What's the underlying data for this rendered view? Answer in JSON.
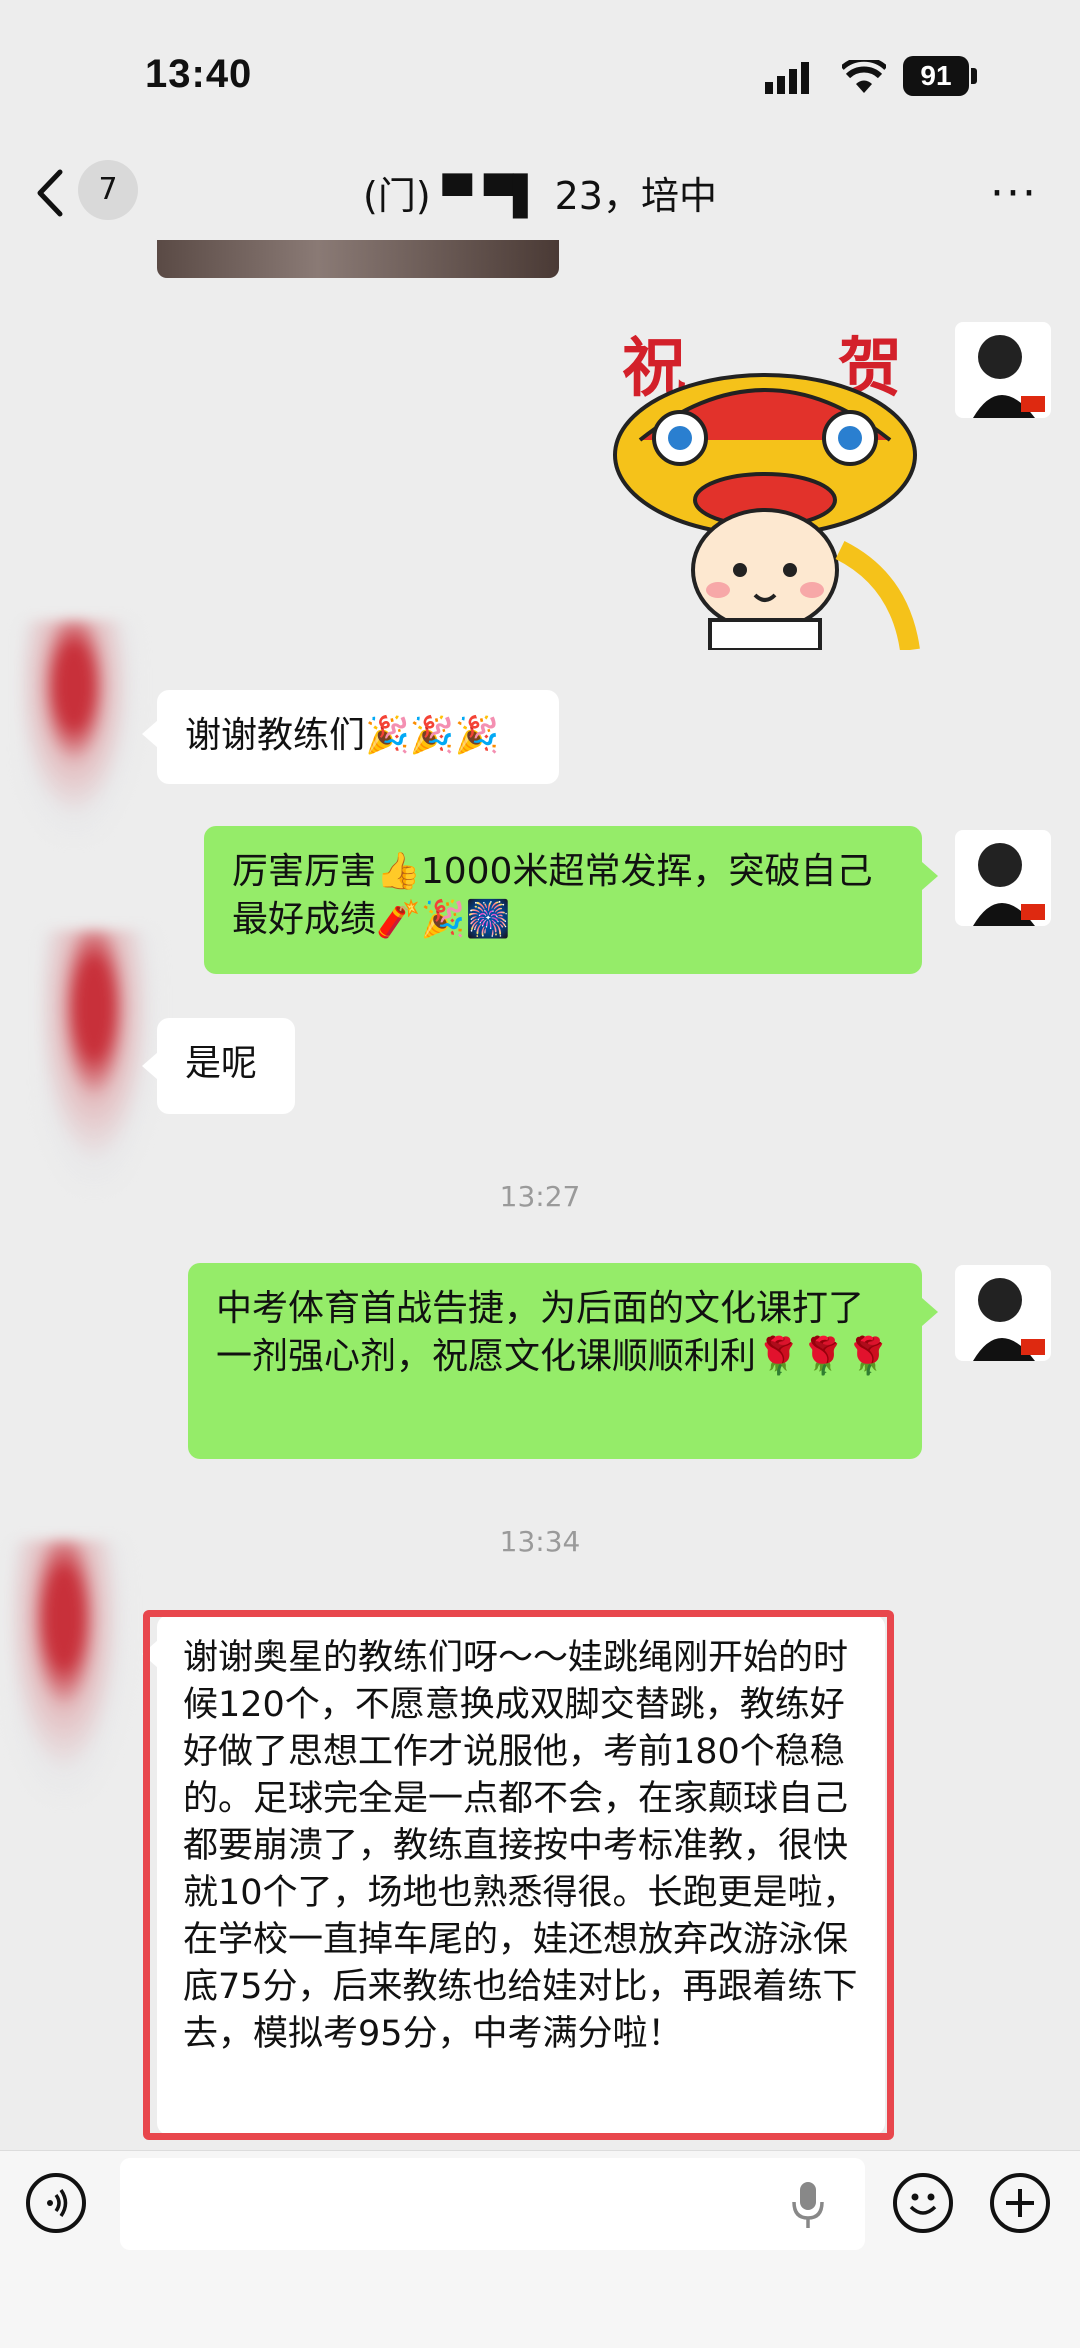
{
  "status": {
    "time": "13:40",
    "battery": "91"
  },
  "nav": {
    "count": "7",
    "title": "(门) ▀ ▀▌ 23，培中",
    "more": "···"
  },
  "sticker": {
    "left_char": "祝",
    "right_char": "贺"
  },
  "messages": {
    "m1": "谢谢教练们🎉🎉🎉",
    "m2": "厉害厉害👍1000米超常发挥，突破自己最好成绩🧨🎉🎆",
    "m3": "是呢",
    "t1": "13:27",
    "m4": "中考体育首战告捷，为后面的文化课打了一剂强心剂，祝愿文化课顺顺利利🌹🌹🌹",
    "t2": "13:34",
    "m5": "谢谢奥星的教练们呀～～娃跳绳刚开始的时候120个，不愿意换成双脚交替跳，教练好好做了思想工作才说服他，考前180个稳稳的。足球完全是一点都不会，在家颠球自己都要崩溃了，教练直接按中考标准教，很快就10个了，场地也熟悉得很。长跑更是啦，在学校一直掉车尾的，娃还想放弃改游泳保底75分，后来教练也给娃对比，再跟着练下去，模拟考95分，中考满分啦！"
  },
  "colors": {
    "green_bubble": "#95ec69",
    "highlight": "#e8474d"
  }
}
